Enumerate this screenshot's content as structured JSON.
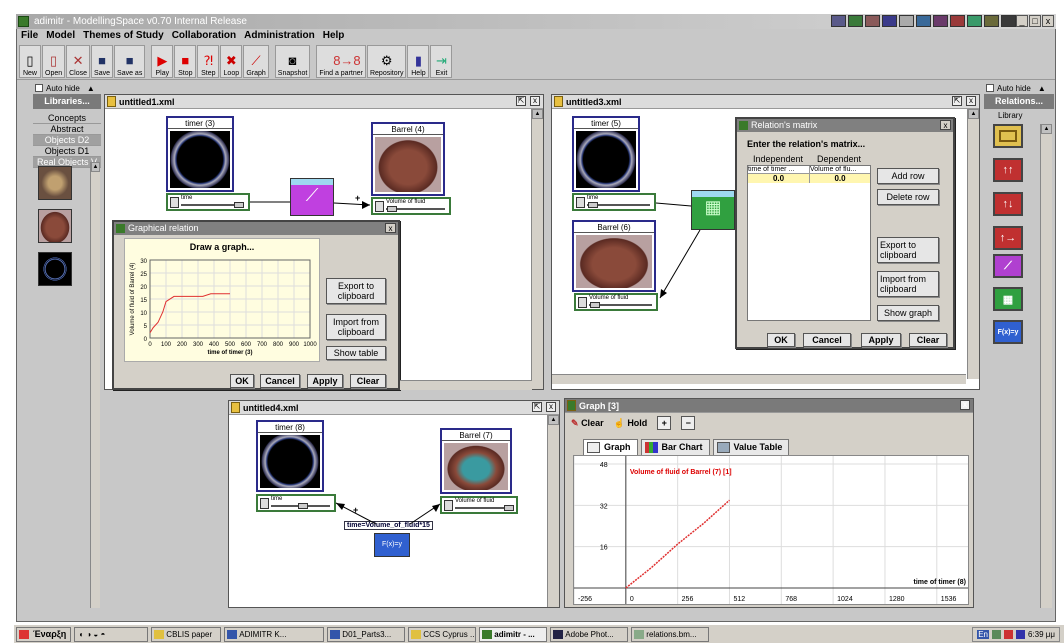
{
  "window": {
    "title": "adimitr - ModellingSpace v0.70 Internal Release"
  },
  "menu": [
    "File",
    "Model",
    "Themes of Study",
    "Collaboration",
    "Administration",
    "Help"
  ],
  "toolbar": [
    {
      "label": "New",
      "icon": "new-icon"
    },
    {
      "label": "Open",
      "icon": "open-icon"
    },
    {
      "label": "Close",
      "icon": "close-icon"
    },
    {
      "label": "Save",
      "icon": "save-icon"
    },
    {
      "label": "Save as",
      "icon": "save-as-icon"
    },
    {
      "label": "Play",
      "icon": "play-icon"
    },
    {
      "label": "Stop",
      "icon": "stop-icon"
    },
    {
      "label": "Step",
      "icon": "step-icon"
    },
    {
      "label": "Loop",
      "icon": "loop-icon"
    },
    {
      "label": "Graph",
      "icon": "graph-icon"
    },
    {
      "label": "Snapshot",
      "icon": "camera-icon"
    },
    {
      "label": "Find a partner",
      "icon": "partner-icon"
    },
    {
      "label": "Repository",
      "icon": "repository-icon"
    },
    {
      "label": "Help",
      "icon": "help-icon"
    },
    {
      "label": "Exit",
      "icon": "exit-icon"
    }
  ],
  "left_panel": {
    "autohide": "Auto hide",
    "title": "Libraries...",
    "categories": [
      "Concepts",
      "Abstract",
      "Objects D2",
      "Objects D1",
      "Real Objects V"
    ]
  },
  "right_panel": {
    "autohide": "Auto hide",
    "title": "Relations...",
    "tab": "Library"
  },
  "win1": {
    "title": "untitled1.xml",
    "timer": "timer (3)",
    "barrel": "Barrel (4)",
    "time_ctrl": "time",
    "vol_ctrl": "Volume of fluid",
    "plus": "+",
    "dialog": {
      "title": "Graphical relation",
      "heading": "Draw a graph...",
      "ylabel": "Volume of fluid of Barrel (4)",
      "xlabel": "time of timer (3)",
      "yticks": [
        "30",
        "25",
        "20",
        "15",
        "10",
        "5",
        "0"
      ],
      "xticks": [
        "0",
        "100",
        "200",
        "300",
        "400",
        "500",
        "600",
        "700",
        "800",
        "900",
        "1000"
      ],
      "btn_export": "Export to clipboard",
      "btn_import": "Import from clipboard",
      "btn_table": "Show table",
      "ok": "OK",
      "cancel": "Cancel",
      "apply": "Apply",
      "clear": "Clear"
    }
  },
  "win3": {
    "title": "untitled3.xml",
    "timer": "timer (5)",
    "barrel": "Barrel (6)",
    "time_ctrl": "time",
    "vol_ctrl": "Volume of fluid",
    "dialog": {
      "title": "Relation's matrix",
      "heading": "Enter the relation's matrix...",
      "col_indep": "Independent",
      "col_dep": "Dependent",
      "h1": "time of timer ...",
      "h2": "Volume of flu...",
      "v1": "0.0",
      "v2": "0.0",
      "add": "Add row",
      "del": "Delete row",
      "export": "Export to clipboard",
      "import": "Import from clipboard",
      "graph": "Show graph",
      "ok": "OK",
      "cancel": "Cancel",
      "apply": "Apply",
      "clear": "Clear"
    }
  },
  "win4": {
    "title": "untitled4.xml",
    "timer": "timer (8)",
    "barrel": "Barrel (7)",
    "time_ctrl": "time",
    "vol_ctrl": "Volume of fluid",
    "plus": "+",
    "formula": "time=Volume_of_fluid*15",
    "fx": "F(x)=y"
  },
  "graph": {
    "title": "Graph [3]",
    "clear": "Clear",
    "hold": "Hold",
    "tabs": [
      "Graph",
      "Bar Chart",
      "Value Table"
    ],
    "series_label": "Volume of fluid of Barrel (7) [1]",
    "xaxis_label": "time of timer (8)",
    "yticks": [
      "48",
      "32",
      "16"
    ],
    "xticks": [
      "-256",
      "0",
      "256",
      "512",
      "768",
      "1024",
      "1280",
      "1536",
      "1"
    ]
  },
  "chart_data": [
    {
      "type": "line",
      "title": "Draw a graph...",
      "xlabel": "time of timer (3)",
      "ylabel": "Volume of fluid of Barrel (4)",
      "xlim": [
        0,
        1000
      ],
      "ylim": [
        0,
        30
      ],
      "series": [
        {
          "x": [
            0,
            20,
            50,
            80,
            100,
            150,
            200,
            250,
            330,
            380,
            500
          ],
          "y": [
            2,
            4,
            6,
            10,
            14,
            16,
            16,
            16,
            16,
            17,
            17
          ]
        }
      ]
    },
    {
      "type": "line",
      "title": "Graph [3]",
      "xlabel": "time of timer (8)",
      "xlim": [
        -256,
        1700
      ],
      "ylim": [
        0,
        48
      ],
      "series": [
        {
          "name": "Volume of fluid of Barrel (7) [1]",
          "x": [
            0,
            128,
            256,
            384,
            512
          ],
          "y": [
            0,
            8,
            17,
            25,
            34
          ]
        }
      ]
    }
  ],
  "taskbar": {
    "start": "Έναρξη",
    "tasks": [
      "CBLIS paper",
      "ADIMITR K...",
      "D01_Parts3...",
      "CCS Cyprus ...",
      "adimitr - ...",
      "Adobe Phot...",
      "relations.bm..."
    ],
    "clock": "6:39 μμ",
    "lang": "En"
  }
}
